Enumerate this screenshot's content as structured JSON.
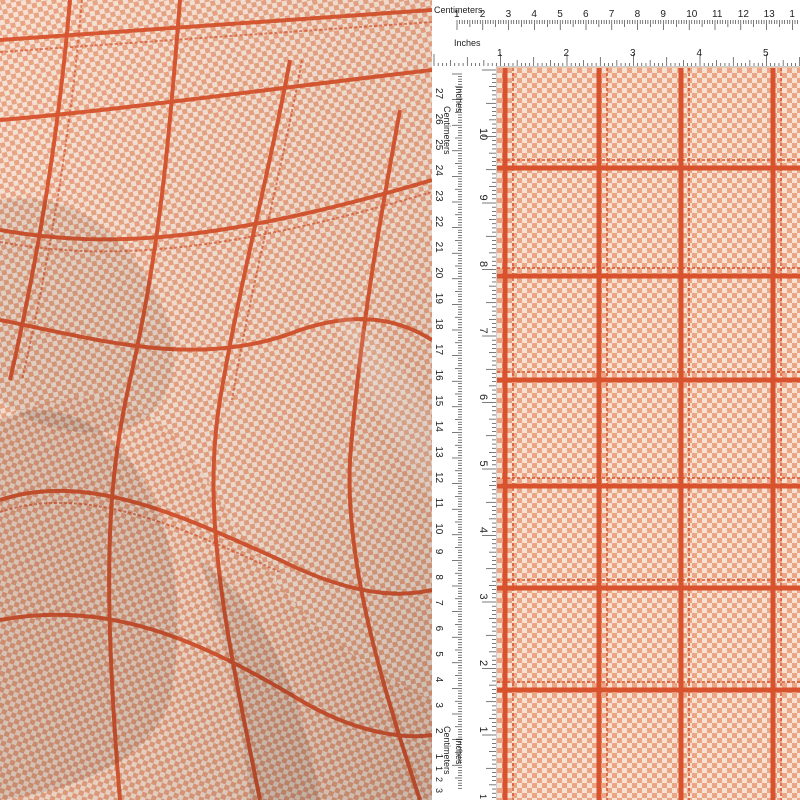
{
  "colors": {
    "base": "#f3d2bf",
    "check_light": "#f6e2d5",
    "check_dark": "#eaa584",
    "stripe": "#d8532d",
    "ruler_bg": "#ffffff",
    "ruler_ink": "#222222"
  },
  "ruler_top": {
    "cm_label": "Centimeters",
    "in_label": "Inches",
    "cm_numbers": [
      "1",
      "2",
      "3",
      "4",
      "5",
      "6",
      "7",
      "8",
      "9",
      "10",
      "11",
      "12",
      "13",
      "1"
    ],
    "in_numbers": [
      "1",
      "2",
      "3",
      "4",
      "5"
    ]
  },
  "ruler_left": {
    "cm_label_top": "Centimeters",
    "in_label_top": "Inches",
    "cm_label_bottom": "Centimeters",
    "in_label_bottom": "Inches",
    "cm_numbers": [
      "27",
      "26",
      "25",
      "24",
      "23",
      "22",
      "21",
      "20",
      "19",
      "18",
      "17",
      "16",
      "15",
      "14",
      "13",
      "12",
      "11",
      "10",
      "9",
      "8",
      "7",
      "6",
      "5",
      "4",
      "3",
      "2",
      "1"
    ],
    "in_numbers": [
      "10",
      "9",
      "8",
      "7",
      "6",
      "5",
      "4",
      "3",
      "2",
      "1"
    ],
    "bottom_cm_numbers": [
      "1",
      "2",
      "3"
    ],
    "bottom_in_numbers": [
      "1"
    ]
  }
}
